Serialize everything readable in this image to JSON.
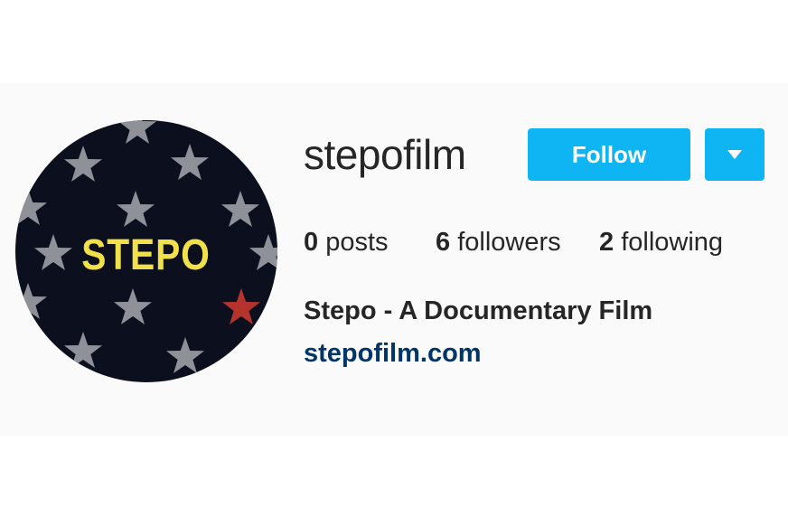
{
  "profile": {
    "username": "stepofilm",
    "full_name": "Stepo - A Documentary Film",
    "website": "stepofilm.com",
    "avatar_text": "STEPO"
  },
  "actions": {
    "follow_label": "Follow",
    "dropdown_icon": "caret-down-icon"
  },
  "stats": {
    "posts": {
      "count": "0",
      "label": "posts"
    },
    "followers": {
      "count": "6",
      "label": "followers"
    },
    "following": {
      "count": "2",
      "label": "following"
    }
  },
  "colors": {
    "button": "#0fb4f3",
    "link": "#003569",
    "avatar_bg": "#0b0f1e",
    "avatar_stars": "#9ea0a6",
    "avatar_red_star": "#b5332d",
    "avatar_text": "#f1e04a"
  }
}
